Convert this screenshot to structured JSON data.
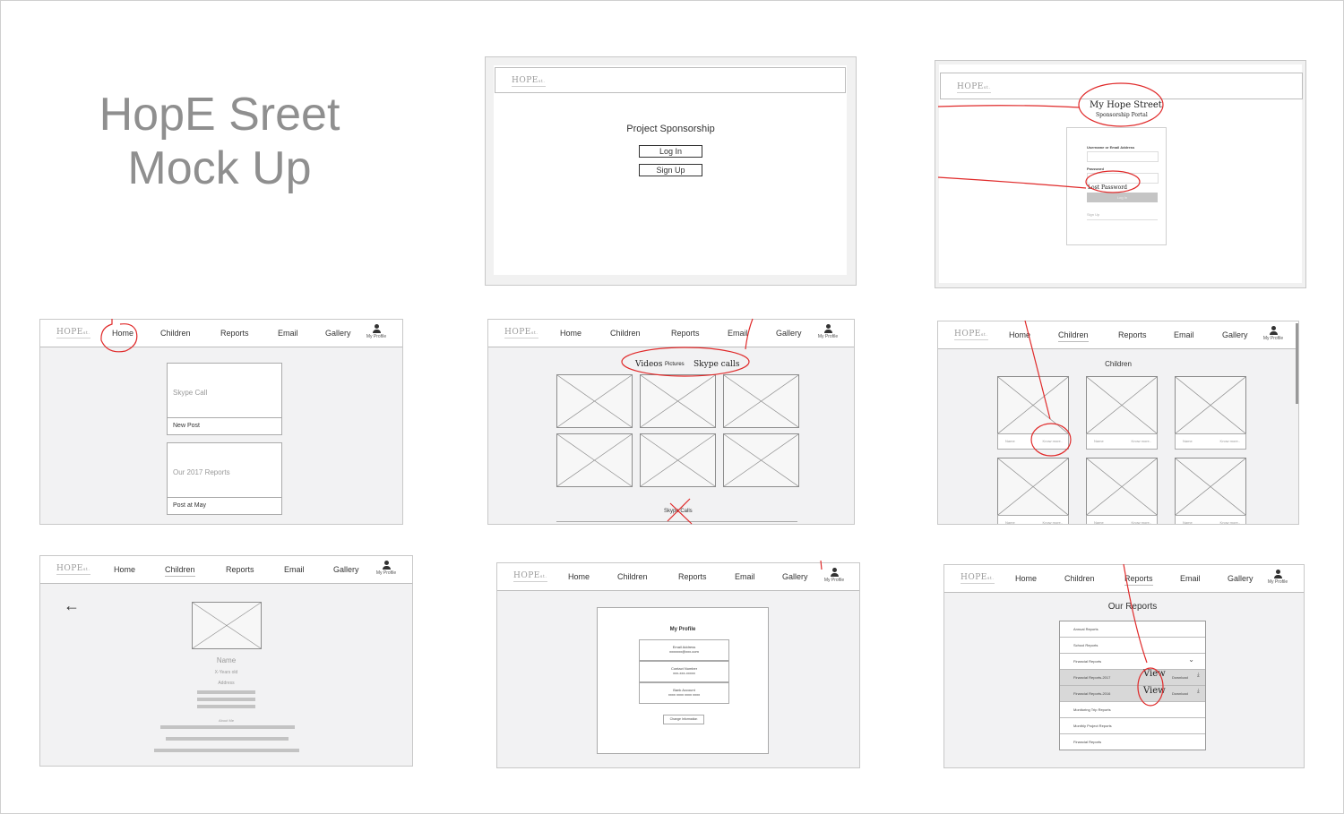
{
  "title": {
    "line1": "HopE Sreet",
    "line2": "Mock Up"
  },
  "logo": {
    "main": "HOPE",
    "suffix": "st."
  },
  "nav": {
    "home": "Home",
    "children": "Children",
    "reports": "Reports",
    "email": "Email",
    "gallery": "Gallery",
    "profile": "My Profile"
  },
  "landing": {
    "heading": "Project Sponsorship",
    "login": "Log  In",
    "signup": "Sign  Up"
  },
  "login": {
    "portal_title": "My Hope Street",
    "portal_subtitle": "Sponsorship Portal",
    "username_label": "Username or Email Address",
    "password_label": "Password",
    "lost_password": "Lost Password",
    "login_button": "Log In",
    "signup_link": "Sign Up"
  },
  "home": {
    "card1_title": "Skype Call",
    "card1_footer": "New Post",
    "card2_title": "Our 2017 Reports",
    "card2_footer": "Post at May"
  },
  "gallery": {
    "videos": "Videos",
    "pictures": "Pictures",
    "skype": "Skype calls",
    "skype_calls_footer": "Skype Calls"
  },
  "children": {
    "heading": "Children",
    "name": "Name",
    "know_more": "Know more.."
  },
  "child_detail": {
    "back": "←",
    "name": "Name",
    "age": "X-Years old",
    "address": "Address",
    "about": "About Me"
  },
  "profile_page": {
    "heading": "My Profile",
    "email_label": "Email Address",
    "email_value": "xxxxxxx@xxx.com",
    "contact_label": "Contact Number",
    "contact_value": "xxx-xxx-xxxxx",
    "bank_label": "Bank Account",
    "bank_value": "xxxx xxxx xxxx xxxx",
    "change_button": "Change Information"
  },
  "reports_page": {
    "heading": "Our Reports",
    "items": [
      "Annual Reports",
      "School Reports",
      "Financial Reports",
      "Financial Reports-2017",
      "Financial Reports-2016",
      "Monitoring Trip Reports",
      "Monthly Project Reports",
      "Financial Reports"
    ],
    "view": "View",
    "download": "Download"
  },
  "colors": {
    "annotation": "#e02a2a",
    "panel_bg": "#f2f2f3",
    "title_gray": "#8f8f8f"
  }
}
